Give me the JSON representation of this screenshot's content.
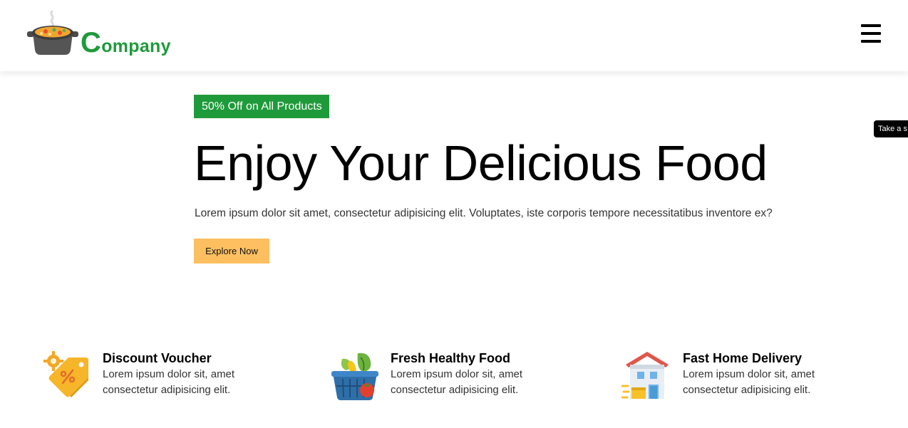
{
  "header": {
    "logo_text_initial": "C",
    "logo_text_rest": "ompany",
    "logo_icon": "soup-pot-icon",
    "menu_icon": "hamburger-menu-icon"
  },
  "tooltip": {
    "label": "Take a s"
  },
  "hero": {
    "badge": "50% Off on All Products",
    "title": "Enjoy Your Delicious Food",
    "description": "Lorem ipsum dolor sit amet, consectetur adipisicing elit. Voluptates, iste corporis tempore necessitatibus inventore ex?",
    "cta_label": "Explore Now"
  },
  "features": [
    {
      "icon": "discount-tag-icon",
      "title": "Discount Voucher",
      "text": "Lorem ipsum dolor sit, amet consectetur adipisicing elit."
    },
    {
      "icon": "vegetable-basket-icon",
      "title": "Fresh Healthy Food",
      "text": "Lorem ipsum dolor sit, amet consectetur adipisicing elit."
    },
    {
      "icon": "delivery-house-icon",
      "title": "Fast Home Delivery",
      "text": "Lorem ipsum dolor sit, amet consectetur adipisicing elit."
    }
  ],
  "colors": {
    "brand_green": "#1f9a3b",
    "cta_orange": "#fdbf60",
    "tooltip_bg": "#000000"
  }
}
